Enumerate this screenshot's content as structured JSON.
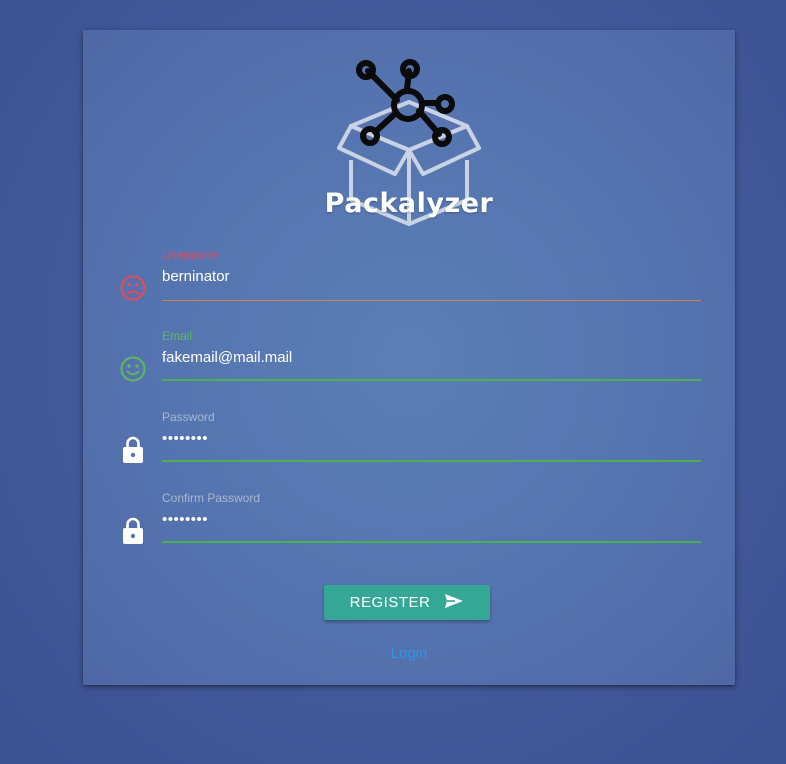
{
  "brand": {
    "name": "Packalyzer",
    "logo_icon": "network-box-logo-icon"
  },
  "form": {
    "username": {
      "label": "Username",
      "value": "berninator",
      "icon": "frown-face-icon",
      "status_color": "#e84a58"
    },
    "email": {
      "label": "Email",
      "value": "fakemail@mail.mail",
      "icon": "smile-face-icon",
      "status_color": "#5cba5e"
    },
    "password": {
      "label": "Password",
      "value": "••••••••",
      "icon": "lock-icon"
    },
    "confirm_password": {
      "label": "Confirm Password",
      "value": "••••••••",
      "icon": "lock-icon"
    }
  },
  "actions": {
    "register_label": "REGISTER",
    "register_icon": "send-icon",
    "login_label": "Login"
  },
  "colors": {
    "accent": "#34a796",
    "link": "#2d95ea",
    "error": "#e84a58",
    "success": "#4caf50"
  }
}
